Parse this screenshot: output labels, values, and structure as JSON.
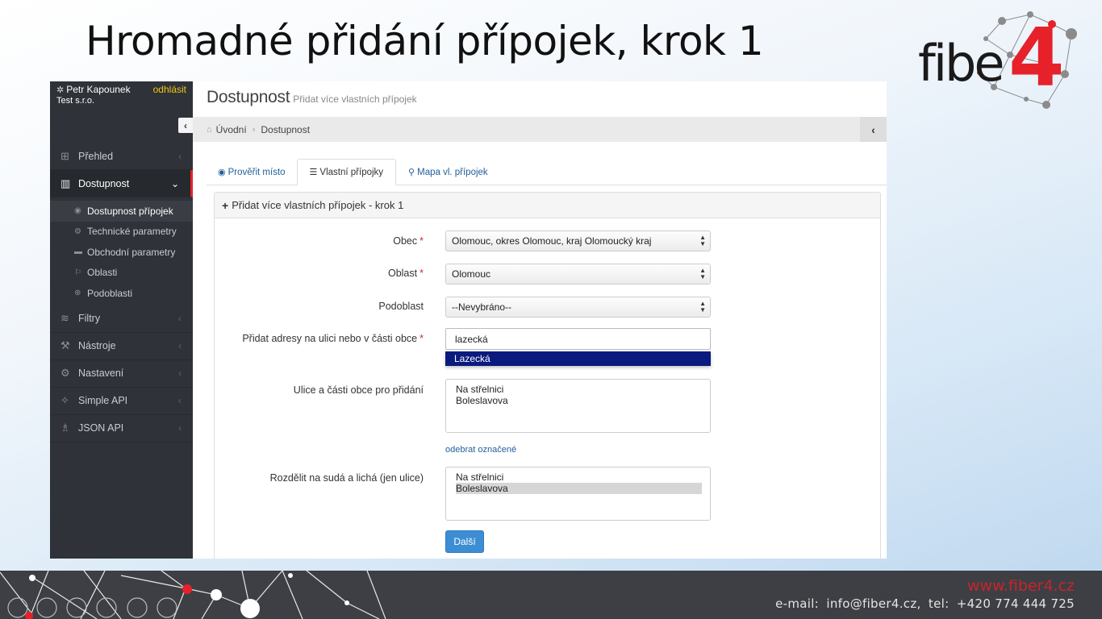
{
  "slide": {
    "title": "Hromadné přidání přípojek, krok 1"
  },
  "logo": {
    "text": "fibe",
    "number": "4"
  },
  "colors": {
    "brand_red": "#e6212a",
    "sidebar": "#2f3238",
    "link": "#1f5f99",
    "primary": "#3c8dd4",
    "autocomplete_bg": "#0b1a7e"
  },
  "user": {
    "name": "Petr Kapounek",
    "company": "Test s.r.o.",
    "logout": "odhlásit",
    "icon": "gear-icon"
  },
  "sidebar": {
    "collapse_icon": "‹",
    "items": [
      {
        "label": "Přehled",
        "icon": "grid-icon"
      },
      {
        "label": "Dostupnost",
        "icon": "map-icon",
        "active": true
      },
      {
        "label": "Filtry",
        "icon": "layers-icon"
      },
      {
        "label": "Nástroje",
        "icon": "wrench-icon"
      },
      {
        "label": "Nastavení",
        "icon": "gear-icon"
      },
      {
        "label": "Simple API",
        "icon": "puzzle-icon"
      },
      {
        "label": "JSON API",
        "icon": "chess-icon"
      }
    ],
    "submenu": [
      {
        "label": "Dostupnost přípojek",
        "active": true
      },
      {
        "label": "Technické parametry"
      },
      {
        "label": "Obchodní parametry"
      },
      {
        "label": "Oblasti"
      },
      {
        "label": "Podoblasti"
      }
    ]
  },
  "header": {
    "title": "Dostupnost",
    "subtitle": "Přidat více vlastních přípojek"
  },
  "breadcrumb": {
    "home": "Úvodní",
    "current": "Dostupnost"
  },
  "tabs": [
    {
      "label": "Prověřit místo",
      "icon": "target-icon"
    },
    {
      "label": "Vlastní přípojky",
      "icon": "list-icon",
      "active": true
    },
    {
      "label": "Mapa vl. přípojek",
      "icon": "map-marker-icon"
    }
  ],
  "panel": {
    "title": "Přidat více vlastních přípojek - krok 1"
  },
  "form": {
    "obec": {
      "label": "Obec",
      "value": "Olomouc, okres Olomouc, kraj Olomoucký kraj"
    },
    "oblast": {
      "label": "Oblast",
      "value": "Olomouc"
    },
    "podoblast": {
      "label": "Podoblast",
      "value": "--Nevybráno--"
    },
    "address": {
      "label": "Přidat adresy na ulici nebo v části obce",
      "value": "lazecká",
      "suggestion": "Lazecká"
    },
    "streets": {
      "label": "Ulice a části obce pro přidání",
      "options": [
        "Na střelnici",
        "Boleslavova"
      ]
    },
    "remove_link": "odebrat označené",
    "split": {
      "label": "Rozdělit na sudá a lichá (jen ulice)",
      "options": [
        "Na střelnici",
        "Boleslavova"
      ],
      "selected_index": 1
    },
    "next_button": "Další"
  },
  "footer": {
    "url": "www.fiber4.cz",
    "contact_label_email": "e-mail:",
    "email": "info@fiber4.cz,",
    "contact_label_tel": "tel:",
    "tel": "+420 774 444 725"
  }
}
